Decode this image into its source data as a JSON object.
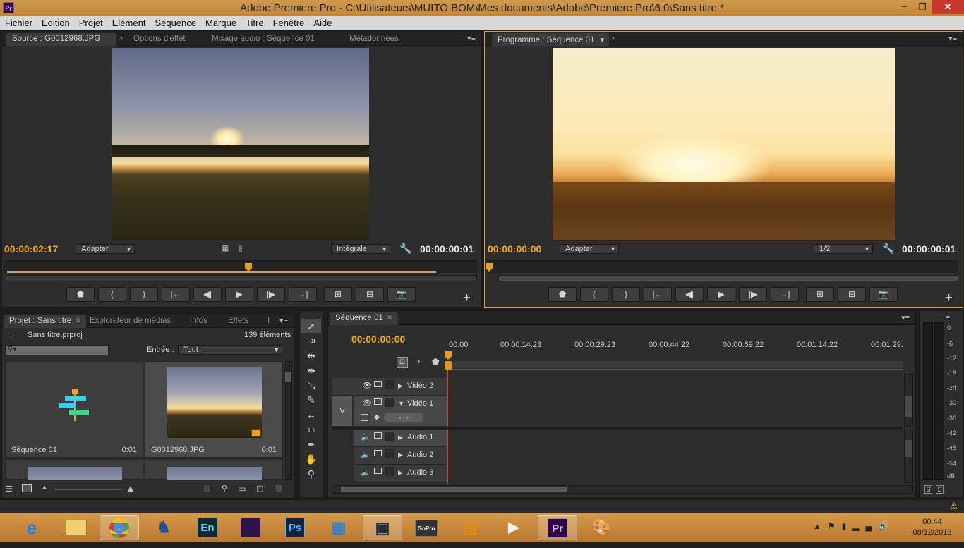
{
  "titlebar": {
    "title": "Adobe Premiere Pro - C:\\Utilisateurs\\MUITO BOM\\Mes documents\\Adobe\\Premiere Pro\\6.0\\Sans titre *",
    "logo": "Pr"
  },
  "window_buttons": {
    "minimize": "−",
    "maximize": "❐",
    "close": "✕"
  },
  "menu": [
    "Fichier",
    "Edition",
    "Projet",
    "Elément",
    "Séquence",
    "Marque",
    "Titre",
    "Fenêtre",
    "Aide"
  ],
  "source_panel": {
    "tabs": [
      "Source : G0012968.JPG",
      "Options d'effet",
      "Mixage audio : Séquence 01",
      "Métadonnées"
    ],
    "timecode_current": "00:00:02:17",
    "fit": "Adapter",
    "quality": "Intégrale",
    "timecode_duration": "00:00:00:01"
  },
  "program_panel": {
    "tabs": [
      "Programme : Séquence 01"
    ],
    "timecode_current": "00:00:00:00",
    "fit": "Adapter",
    "resolution": "1/2",
    "timecode_duration": "00:00:00:01"
  },
  "project_panel": {
    "tabs": [
      "Projet : Sans titre",
      "Explorateur de médias",
      "Infos",
      "Effets",
      "I"
    ],
    "project_name": "Sans titre.prproj",
    "count": "139 éléments",
    "entry_label": "Entrée :",
    "entry_value": "Tout",
    "items": [
      {
        "name": "Séquence 01",
        "duration": "0:01"
      },
      {
        "name": "G0012968.JPG",
        "duration": "0:01"
      }
    ]
  },
  "timeline": {
    "tab": "Séquence 01",
    "timecode": "00:00:00:00",
    "ruler": [
      "00:00",
      "00:00:14:23",
      "00:00:29:23",
      "00:00:44:22",
      "00:00:59:22",
      "00:01:14:22",
      "00:01:29:"
    ],
    "tracks": {
      "v_target": "V",
      "video": [
        "Vidéo 2",
        "Vidéo 1"
      ],
      "audio": [
        "Audio 1",
        "Audio 2",
        "Audio 3"
      ]
    }
  },
  "vu_meter": {
    "scale": [
      "0",
      "-6",
      "-12",
      "-18",
      "-24",
      "-30",
      "-36",
      "-42",
      "-48",
      "-54",
      "dB"
    ],
    "solo": "S"
  },
  "taskbar": {
    "apps": [
      "ie",
      "explorer",
      "chrome",
      "app4",
      "En",
      "app6",
      "Ps",
      "app8",
      "app9",
      "GoPro",
      "app11",
      "app12",
      "Pr",
      "app14"
    ],
    "clock_time": "00:44",
    "clock_date": "08/12/2013"
  },
  "colors": {
    "timecode": "#f2a423",
    "accent_border": "#d9a23a",
    "playhead": "#e6a020"
  }
}
